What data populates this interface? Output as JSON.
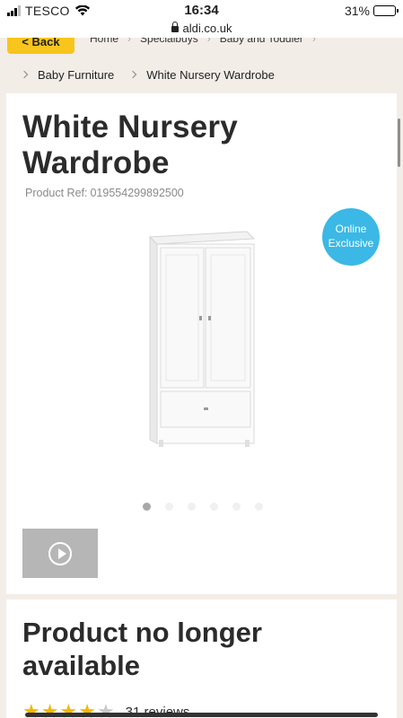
{
  "status": {
    "carrier": "TESCO",
    "time": "16:34",
    "battery": "31%",
    "battery_level": 0.31
  },
  "url": "aldi.co.uk",
  "nav": {
    "back": "< Back",
    "top_crumbs": [
      "Home",
      "Specialbuys",
      "Baby and Toddler"
    ],
    "crumbs": [
      "Baby Furniture",
      "White Nursery Wardrobe"
    ]
  },
  "product": {
    "title": "White Nursery Wardrobe",
    "ref_label": "Product Ref:",
    "ref": "019554299892500",
    "badge_line1": "Online",
    "badge_line2": "Exclusive",
    "image_count": 6,
    "active_image": 0
  },
  "availability": {
    "message": "Product no longer available",
    "rating": 4,
    "max_rating": 5,
    "reviews": "31 reviews"
  },
  "icons": [
    "signal-icon",
    "wifi-icon",
    "battery-icon",
    "lock-icon",
    "chevron-right-icon",
    "play-icon",
    "star-icon"
  ]
}
